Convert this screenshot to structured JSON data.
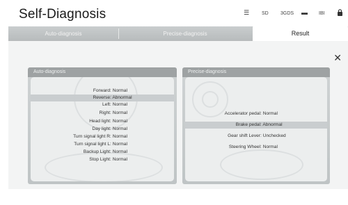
{
  "header": {
    "title": "Self-Diagnosis",
    "status": {
      "wifi_icon": "wifi-icon",
      "sd": "SD",
      "gps": "3GDS",
      "usb_icon": "usb-icon",
      "bt": "IBI",
      "lock_icon": "lock-icon"
    }
  },
  "tabs": [
    {
      "label": "Auto-diagnosis"
    },
    {
      "label": "Precise-diagnosis"
    },
    {
      "label": "Result"
    }
  ],
  "close_icon": "close-icon",
  "auto_panel": {
    "title": "Auto-diagnosis",
    "rows": [
      {
        "label": "Forward",
        "sep": ":",
        "value": "Normal"
      },
      {
        "label": "Reverse",
        "sep": ":",
        "value": "Abnormal"
      },
      {
        "label": "Left",
        "sep": ":",
        "value": "Normal"
      },
      {
        "label": "Right",
        "sep": ":",
        "value": "Normal"
      },
      {
        "label": "Head light",
        "sep": ":",
        "value": "Normal"
      },
      {
        "label": "Day light",
        "sep": ":",
        "value": "Normal"
      },
      {
        "label": "Turn signal light R",
        "sep": ":",
        "value": "Normal"
      },
      {
        "label": "Turn signal light L",
        "sep": ":",
        "value": "Normal"
      },
      {
        "label": "Backup Light",
        "sep": ":",
        "value": "Normal"
      },
      {
        "label": "Stop Light",
        "sep": ":",
        "value": "Normal"
      }
    ]
  },
  "precise_panel": {
    "title": "Precise-diagnosis",
    "rows": [
      {
        "label": "Accelerator pedal",
        "sep": ":",
        "value": "Normal"
      },
      {
        "label": "Brake pedal",
        "sep": ":",
        "value": "Abnormal"
      },
      {
        "label": "Gear shift Lever",
        "sep": ":",
        "value": "Unchecked"
      },
      {
        "label": "Steering Wheel",
        "sep": ":",
        "value": "Normal"
      }
    ]
  }
}
